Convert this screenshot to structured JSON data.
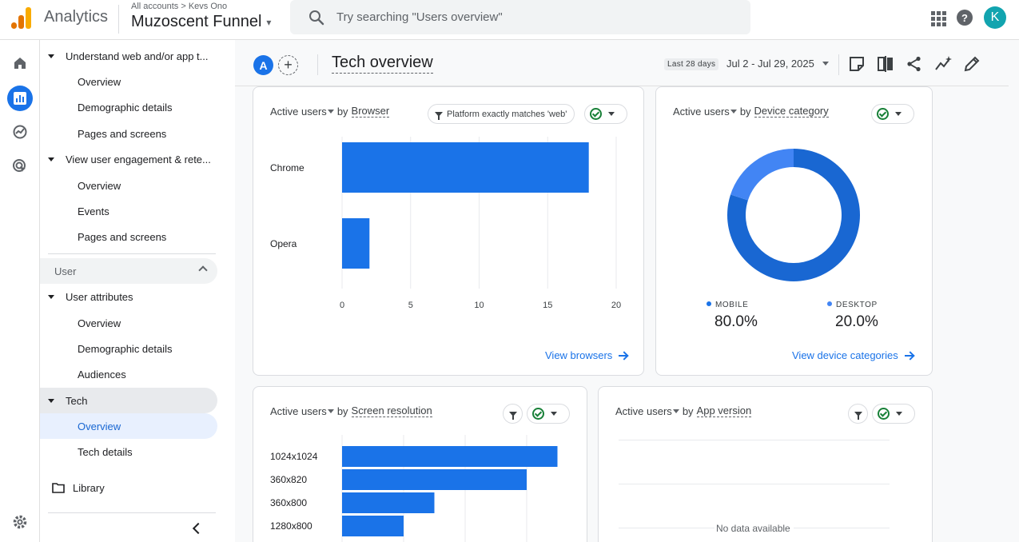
{
  "topbar": {
    "app_name": "Analytics",
    "breadcrumb": "All accounts > Kevs Ono",
    "property": "Muzoscent Funnel",
    "search_placeholder": "Try searching \"Users overview\"",
    "avatar_letter": "K",
    "help_glyph": "?"
  },
  "sidebar": {
    "group1_title": "Understand web and/or app t...",
    "group1_items": [
      "Overview",
      "Demographic details",
      "Pages and screens"
    ],
    "group2_title": "View user engagement & rete...",
    "group2_items": [
      "Overview",
      "Events",
      "Pages and screens"
    ],
    "section_user": "User",
    "group3_title": "User attributes",
    "group3_items": [
      "Overview",
      "Demographic details",
      "Audiences"
    ],
    "group4_title": "Tech",
    "group4_items": [
      "Overview",
      "Tech details"
    ],
    "library": "Library"
  },
  "header": {
    "segment_letter": "A",
    "add_glyph": "+",
    "title": "Tech overview",
    "date_chip": "Last 28 days",
    "date_range": "Jul 2 - Jul 29, 2025"
  },
  "cards": {
    "browser": {
      "metric": "Active users",
      "by": "by",
      "dimension": "Browser",
      "filter": "Platform exactly matches 'web'",
      "link": "View browsers"
    },
    "device": {
      "metric": "Active users",
      "by": "by",
      "dimension": "Device category",
      "mobile_label": "MOBILE",
      "mobile_value": "80.0%",
      "desktop_label": "DESKTOP",
      "desktop_value": "20.0%",
      "link": "View device categories"
    },
    "screen": {
      "metric": "Active users",
      "by": "by",
      "dimension": "Screen resolution"
    },
    "app": {
      "metric": "Active users",
      "by": "by",
      "dimension": "App version",
      "no_data": "No data available"
    }
  },
  "colors": {
    "accent": "#1a73e8",
    "bar": "#1a73e8",
    "donut_mobile": "#1967d2",
    "donut_desktop": "#4285f4",
    "ok_green": "#188038"
  },
  "chart_data": [
    {
      "type": "bar",
      "orientation": "horizontal",
      "categories": [
        "Chrome",
        "Opera"
      ],
      "values": [
        18,
        2
      ],
      "xticks": [
        "0",
        "5",
        "10",
        "15",
        "20"
      ],
      "xlim": [
        0,
        20
      ],
      "grid": true
    },
    {
      "type": "pie",
      "donut": true,
      "categories": [
        "MOBILE",
        "DESKTOP"
      ],
      "values": [
        80.0,
        20.0
      ]
    },
    {
      "type": "bar",
      "orientation": "horizontal",
      "categories": [
        "1024x1024",
        "360x820",
        "360x800",
        "1280x800"
      ],
      "values": [
        7,
        6,
        3,
        2
      ],
      "xlim": [
        0,
        8
      ],
      "grid": true
    }
  ]
}
